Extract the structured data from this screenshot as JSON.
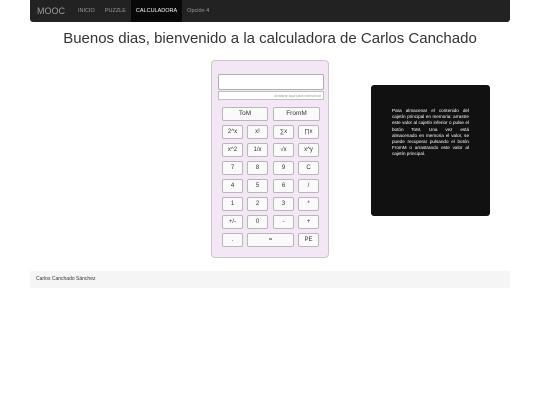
{
  "nav": {
    "brand": "MOOC",
    "items": [
      {
        "label": "INICIO",
        "active": false
      },
      {
        "label": "PUZZLE",
        "active": false
      },
      {
        "label": "CALCULADORA",
        "active": true
      },
      {
        "label": "Opción 4",
        "active": false
      }
    ]
  },
  "heading": "Buenos dias, bienvenido a la calculadora de Carlos Canchado",
  "calculator": {
    "display_value": "",
    "memory_placeholder": "Arrastrar aquí para memorizar",
    "buttons": {
      "to_m": "ToM",
      "from_m": "FromM",
      "pow2x": "2^x",
      "factorial": "x!",
      "sum": "∑x",
      "product": "∏x",
      "square": "x^2",
      "inverse": "1/x",
      "sqrt": "√x",
      "power": "x^y",
      "n7": "7",
      "n8": "8",
      "n9": "9",
      "clear": "C",
      "n4": "4",
      "n5": "5",
      "n6": "6",
      "divide": "/",
      "n1": "1",
      "n2": "2",
      "n3": "3",
      "multiply": "*",
      "negate": "+/-",
      "n0": "0",
      "subtract": "-",
      "add": "+",
      "decimal": ".",
      "equals": "=",
      "pe": "PE"
    }
  },
  "info_text": "Para almacenar el contenido del cajetín principal en memoria: arrastre este valor al cajetín inferior o pulse el botón ToM. Una vez está almacenado en memoria el valor, se puede recuperar pulsando el botón FromM o arrastrando este valor al cajetín principal.",
  "footer": {
    "text": "Carlos Canchado Sánchez"
  },
  "colors": {
    "navbar": "#222222",
    "calculator_bg": "#f3e7f5",
    "info_box": "#111111",
    "footer_bg": "#f5f5f5"
  }
}
